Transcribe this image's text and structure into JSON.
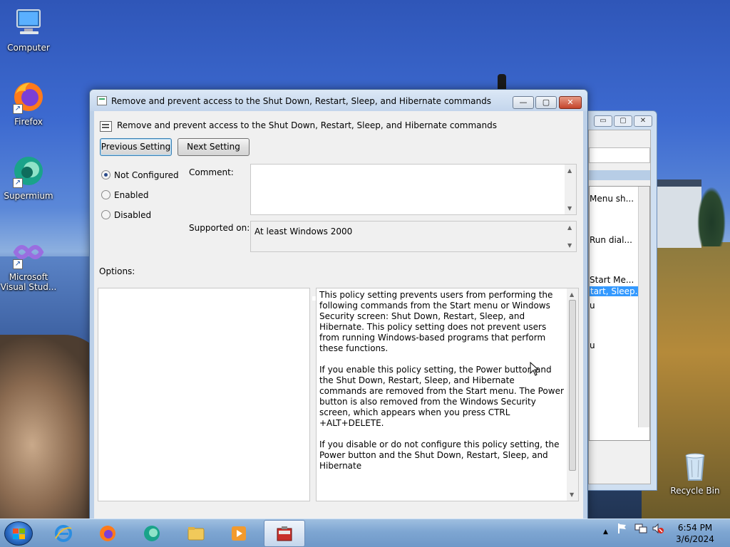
{
  "desktop": {
    "icons": [
      {
        "label": "Computer"
      },
      {
        "label": "Firefox"
      },
      {
        "label": "Supermium"
      },
      {
        "label": "Microsoft Visual Stud..."
      },
      {
        "label": "Recycle Bin"
      }
    ]
  },
  "back_window": {
    "items": [
      "Menu sh...",
      "Run dial...",
      "Start Me...",
      "tart, Sleep...",
      "u",
      "u"
    ],
    "ctrl_min": "▭",
    "ctrl_max": "▢",
    "ctrl_close": "✕"
  },
  "window": {
    "title": "Remove and prevent access to the Shut Down, Restart, Sleep, and Hibernate commands",
    "header": "Remove and prevent access to the Shut Down, Restart, Sleep, and Hibernate commands",
    "min_label": "—",
    "max_label": "▢",
    "close_label": "✕",
    "prev_button": "Previous Setting",
    "next_button": "Next Setting",
    "radios": [
      {
        "label": "Not Configured",
        "selected": true
      },
      {
        "label": "Enabled",
        "selected": false
      },
      {
        "label": "Disabled",
        "selected": false
      }
    ],
    "comment_label": "Comment:",
    "comment_value": "",
    "supported_label": "Supported on:",
    "supported_value": "At least Windows 2000",
    "options_label": "Options:",
    "help_text": "This policy setting prevents users from performing the following commands from the Start menu or Windows Security screen: Shut Down, Restart, Sleep, and Hibernate. This policy setting does not prevent users from running Windows-based programs that perform these functions.\n\nIf you enable this policy setting, the Power button and the Shut Down, Restart, Sleep, and Hibernate commands are removed from the Start menu. The Power button is also removed from the Windows Security screen, which appears when you press CTRL +ALT+DELETE.\n\nIf you disable or do not configure this policy setting, the Power button and the Shut Down, Restart, Sleep, and Hibernate"
  },
  "taskbar": {
    "items": [
      "start-button",
      "internet-explorer",
      "firefox",
      "supermium",
      "file-explorer",
      "media-player",
      "group-policy-editor"
    ],
    "time": "6:54 PM",
    "date": "3/6/2024",
    "tray_arrow": "▲"
  },
  "colors": {
    "accent": "#3c7fb1",
    "close_red": "#c4442b",
    "selection": "#3399ff"
  }
}
